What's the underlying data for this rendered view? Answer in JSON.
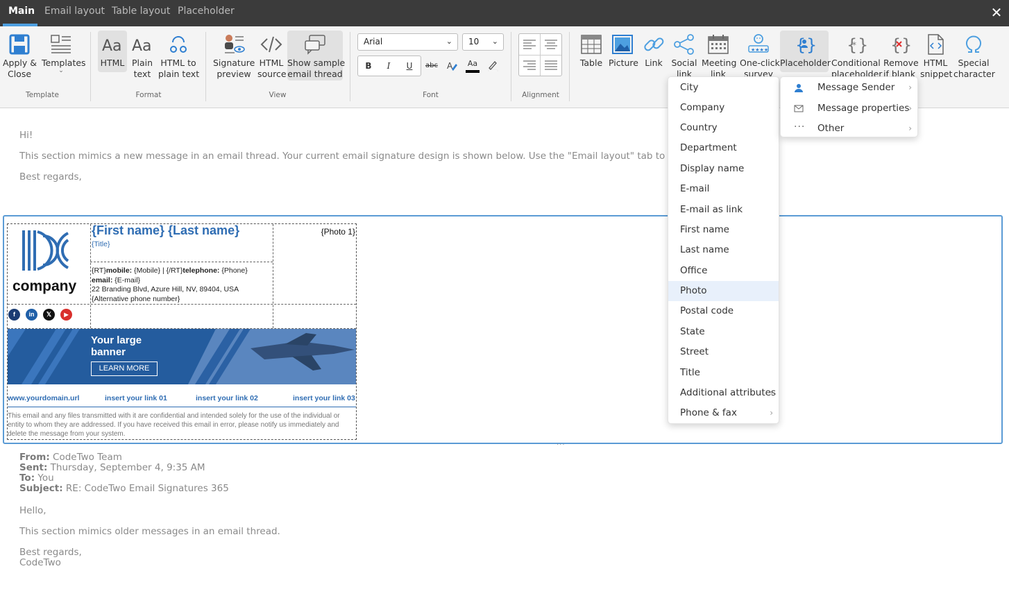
{
  "tabs": [
    "Main",
    "Email layout",
    "Table layout",
    "Placeholder"
  ],
  "ribbon": {
    "template": {
      "apply_close": [
        "Apply &",
        "Close"
      ],
      "templates": "Templates",
      "group": "Template"
    },
    "format": {
      "html": "HTML",
      "plain_text": [
        "Plain",
        "text"
      ],
      "html_to_plain": [
        "HTML to",
        "plain text"
      ],
      "group": "Format"
    },
    "view": {
      "signature_preview": [
        "Signature",
        "preview"
      ],
      "html_source": [
        "HTML",
        "source"
      ],
      "show_sample": [
        "Show sample",
        "email thread"
      ],
      "group": "View"
    },
    "font": {
      "family": "Arial",
      "size": "10",
      "bold": "B",
      "italic": "I",
      "underline": "U",
      "strike": "abc",
      "color_glyph": "Aa",
      "group": "Font"
    },
    "alignment": {
      "group": "Alignment"
    },
    "insert": {
      "table": "Table",
      "picture": "Picture",
      "link": "Link",
      "social_link": [
        "Social",
        "link"
      ],
      "meeting_link": [
        "Meeting",
        "link"
      ],
      "one_click_survey": [
        "One-click",
        "survey"
      ],
      "placeholder": "Placeholder",
      "conditional_placeholder": [
        "Conditional",
        "placeholder"
      ],
      "remove_if_blank": [
        "Remove",
        "if blank"
      ],
      "html_snippet": [
        "HTML",
        "snippet"
      ],
      "special_character": [
        "Special",
        "character"
      ]
    }
  },
  "new_message": {
    "greeting": "Hi!",
    "body": "This section mimics a new message in an email thread. Your current email signature design is shown below. Use the \"Email layout\" tab to change the po",
    "closing": "Best regards,"
  },
  "signature": {
    "company_word": "company",
    "name": "{First name} {Last name}",
    "title": "{Title}",
    "photo": "{Photo 1}",
    "contact": {
      "l1_pre": "{RT}",
      "l1_mobile_label": "mobile:",
      "l1_mobile": " {Mobile}  |  {/RT}",
      "l1_tel_label": "telephone:",
      "l1_tel": " {Phone}",
      "email_label": "email:",
      "email": " {E-mail}",
      "address": "22 Branding Blvd, Azure Hill, NV, 89404, USA",
      "alt_phone": "{Alternative phone number}"
    },
    "social": {
      "facebook": "f",
      "linkedin": "in",
      "x": "𝕏",
      "youtube": "▶"
    },
    "banner": {
      "title_l1": "Your large",
      "title_l2": "banner",
      "button": "LEARN MORE"
    },
    "links": [
      "www.yourdomain.url",
      "insert your link 01",
      "insert your link 02",
      "insert your link 03"
    ],
    "disclaimer": "This email and any files transmitted with it are confidential and intended solely for the use of the individual or entity to whom they are addressed. If you have received this email in error, please notify us immediately and delete the message from your system."
  },
  "older_message": {
    "from_label": "From:",
    "from": " CodeTwo Team",
    "sent_label": "Sent:",
    "sent": " Thursday, September 4, 9:35 AM",
    "to_label": "To:",
    "to": " You",
    "subject_label": "Subject:",
    "subject": " RE: CodeTwo Email Signatures 365",
    "greeting": "Hello,",
    "body": "This section mimics older messages in an email thread.",
    "closing_1": "Best regards,",
    "closing_2": "CodeTwo"
  },
  "placeholder_menu": {
    "items": [
      "City",
      "Company",
      "Country",
      "Department",
      "Display name",
      "E-mail",
      "E-mail as link",
      "First name",
      "Last name",
      "Office",
      "Photo",
      "Postal code",
      "State",
      "Street",
      "Title",
      "Additional attributes",
      "Phone & fax"
    ],
    "highlighted": "Photo"
  },
  "submenu": {
    "items": [
      "Message Sender",
      "Message properties",
      "Other"
    ]
  },
  "colors": {
    "accent": "#4d9fe0",
    "brand_blue": "#2f6db3",
    "topbar": "#3b3b3b"
  }
}
